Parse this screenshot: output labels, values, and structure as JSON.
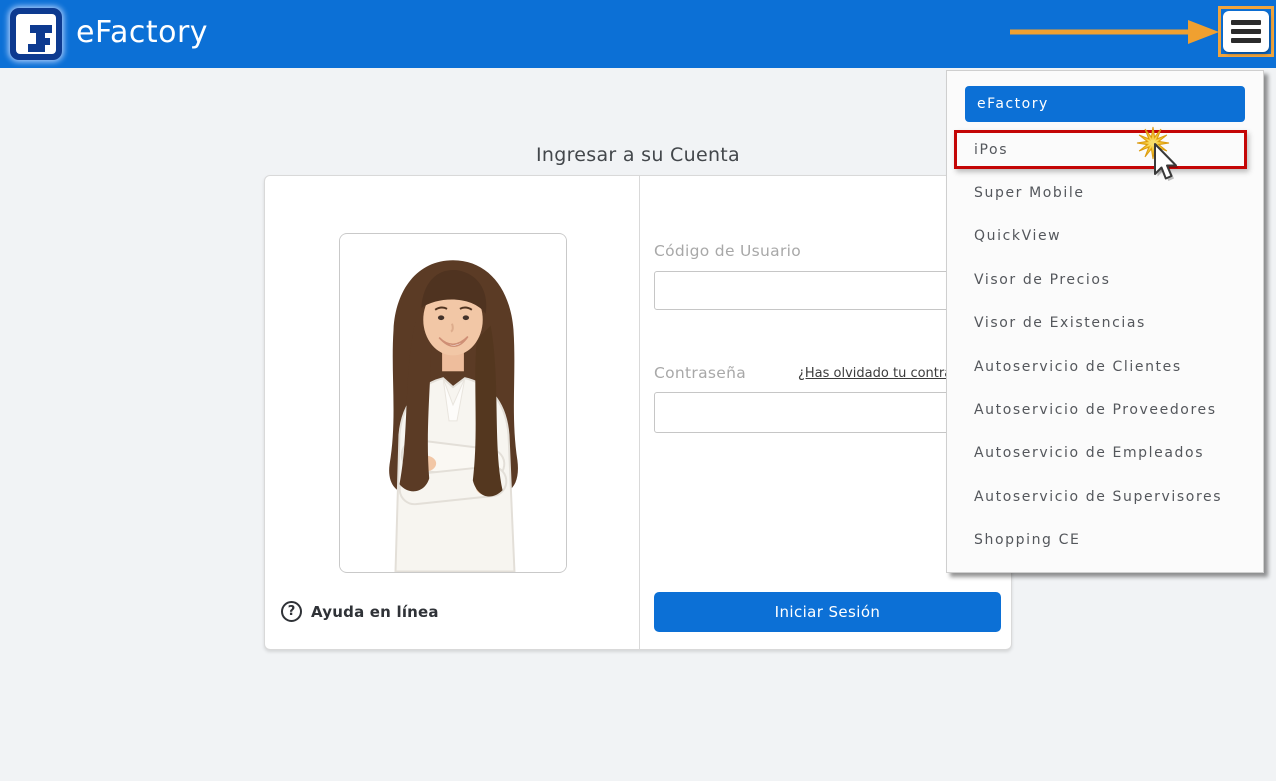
{
  "header": {
    "brand": "eFactory"
  },
  "login": {
    "title": "Ingresar a su Cuenta",
    "username_label": "Código de Usuario",
    "username_value": "",
    "password_label": "Contraseña",
    "password_value": "",
    "forgot_link": "¿Has olvidado tu contraseña?",
    "submit_label": "Iniciar Sesión",
    "help_label": "Ayuda en línea"
  },
  "menu": {
    "items": [
      {
        "label": "eFactory",
        "active": true
      },
      {
        "label": "iPos",
        "annotated": true
      },
      {
        "label": "Super Mobile"
      },
      {
        "label": "QuickView"
      },
      {
        "label": "Visor de Precios"
      },
      {
        "label": "Visor de Existencias"
      },
      {
        "label": "Autoservicio de Clientes"
      },
      {
        "label": "Autoservicio de Proveedores"
      },
      {
        "label": "Autoservicio de Empleados"
      },
      {
        "label": "Autoservicio de Supervisores"
      },
      {
        "label": "Shopping CE"
      }
    ]
  },
  "colors": {
    "accent_blue": "#0c70d6",
    "annotation_orange": "#f0a030",
    "annotation_red": "#c40606",
    "logo_navy": "#0d3a90"
  },
  "icons": {
    "hamburger": "menu-icon",
    "help": "question-mark-icon",
    "cursor": "cursor-icon",
    "click": "click-starburst-icon"
  }
}
